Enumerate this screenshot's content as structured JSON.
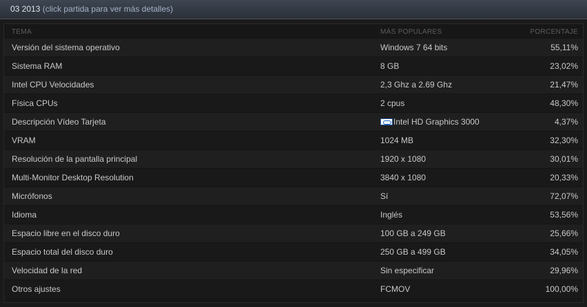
{
  "header": {
    "period": "03 2013",
    "hint": "(click partida para ver más detalles)"
  },
  "table": {
    "columns": {
      "tema": "TEMA",
      "popular": "MÁS POPULARES",
      "percent": "PORCENTAJE"
    },
    "rows": [
      {
        "tema": "Versión del sistema operativo",
        "popular": "Windows 7 64 bits",
        "percent": "55,11%"
      },
      {
        "tema": "Sistema RAM",
        "popular": "8 GB",
        "percent": "23,02%"
      },
      {
        "tema": "Intel CPU Velocidades",
        "popular": "2,3 Ghz a 2.69 Ghz",
        "percent": "21,47%"
      },
      {
        "tema": "Física CPUs",
        "popular": "2 cpus",
        "percent": "48,30%"
      },
      {
        "tema": "Descripción Vídeo Tarjeta",
        "popular": "Intel HD Graphics 3000",
        "percent": "4,37%",
        "icon": "intel-logo-icon"
      },
      {
        "tema": "VRAM",
        "popular": "1024 MB",
        "percent": "32,30%"
      },
      {
        "tema": "Resolución de la pantalla principal",
        "popular": "1920 x 1080",
        "percent": "30,01%"
      },
      {
        "tema": "Multi-Monitor Desktop Resolution",
        "popular": "3840 x 1080",
        "percent": "20,33%"
      },
      {
        "tema": "Micrófonos",
        "popular": "Sí",
        "percent": "72,07%"
      },
      {
        "tema": "Idioma",
        "popular": "Inglés",
        "percent": "53,56%"
      },
      {
        "tema": "Espacio libre en el disco duro",
        "popular": "100 GB a 249 GB",
        "percent": "25,66%"
      },
      {
        "tema": "Espacio total del disco duro",
        "popular": "250 GB a 499 GB",
        "percent": "34,05%"
      },
      {
        "tema": "Velocidad de la red",
        "popular": "Sin especificar",
        "percent": "29,96%"
      },
      {
        "tema": "Otros ajustes",
        "popular": "FCMOV",
        "percent": "100,00%"
      }
    ]
  }
}
